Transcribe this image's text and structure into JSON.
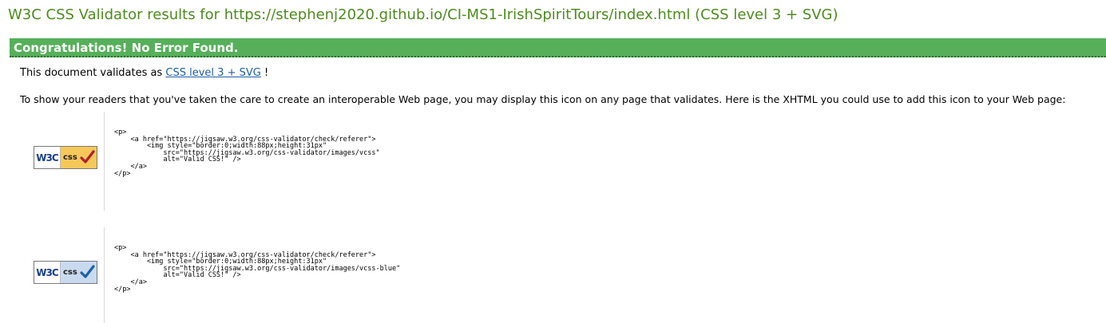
{
  "header": {
    "title": "W3C CSS Validator results for https://stephenj2020.github.io/CI-MS1-IrishSpiritTours/index.html (CSS level 3 + SVG)"
  },
  "banner": {
    "text": "Congratulations! No Error Found."
  },
  "validates": {
    "prefix": "This document validates as ",
    "link_text": "CSS level 3 + SVG",
    "suffix": " !"
  },
  "instructions": {
    "text": "To show your readers that you've taken the care to create an interoperable Web page, you may display this icon on any page that validates. Here is the XHTML you could use to add this icon to your Web page:"
  },
  "badges": [
    {
      "w3c_label": "W3C",
      "css_label": "css",
      "check_color": "#b3202a",
      "style": "gold",
      "code": "<p>\n    <a href=\"https://jigsaw.w3.org/css-validator/check/referer\">\n        <img style=\"border:0;width:88px;height:31px\"\n            src=\"https://jigsaw.w3.org/css-validator/images/vcss\"\n            alt=\"Valid CSS!\" />\n    </a>\n</p>"
    },
    {
      "w3c_label": "W3C",
      "css_label": "css",
      "check_color": "#1f5fa6",
      "style": "blue",
      "code": "<p>\n    <a href=\"https://jigsaw.w3.org/css-validator/check/referer\">\n        <img style=\"border:0;width:88px;height:31px\"\n            src=\"https://jigsaw.w3.org/css-validator/images/vcss-blue\"\n            alt=\"Valid CSS!\" />\n    </a>\n</p>"
    }
  ],
  "colors": {
    "title": "#4d8c1e",
    "banner_bg": "#56b05a",
    "link": "#1f5fa6"
  }
}
